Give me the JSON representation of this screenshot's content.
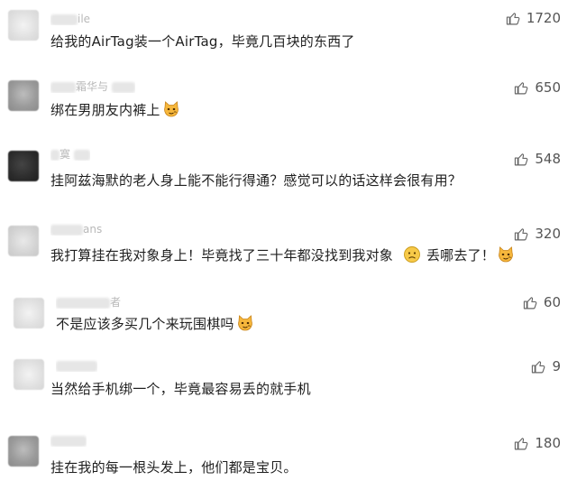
{
  "comments": [
    {
      "name": "ile",
      "text": "给我的AirTag装一个AirTag，毕竟几百块的东西了",
      "likes": "1720",
      "emoji": null
    },
    {
      "name": "霜华与",
      "text": "绑在男朋友内裤上",
      "likes": "650",
      "emoji": "cat-face"
    },
    {
      "name": "寞",
      "text": "挂阿兹海默的老人身上能不能行得通？感觉可以的话这样会很有用？",
      "likes": "548",
      "emoji": null
    },
    {
      "name": "ans",
      "text_part1": "我打算挂在我对象身上！毕竟找了三十年都没找到我对象",
      "text_part2": "丢哪去了！",
      "likes": "320",
      "emoji": "cat-face"
    },
    {
      "name": "者",
      "text": "不是应该多买几个来玩围棋吗",
      "likes": "60",
      "emoji": "cat-face"
    },
    {
      "name": "",
      "text": "当然给手机绑一个，毕竟最容易丢的就手机",
      "likes": "9",
      "emoji": null
    },
    {
      "name": "",
      "text": "挂在我的每一根头发上，他们都是宝贝。",
      "likes": "180",
      "emoji": null
    }
  ],
  "colors": {
    "text": "#1f1f1f",
    "likes": "#555555",
    "icon": "#666666"
  }
}
